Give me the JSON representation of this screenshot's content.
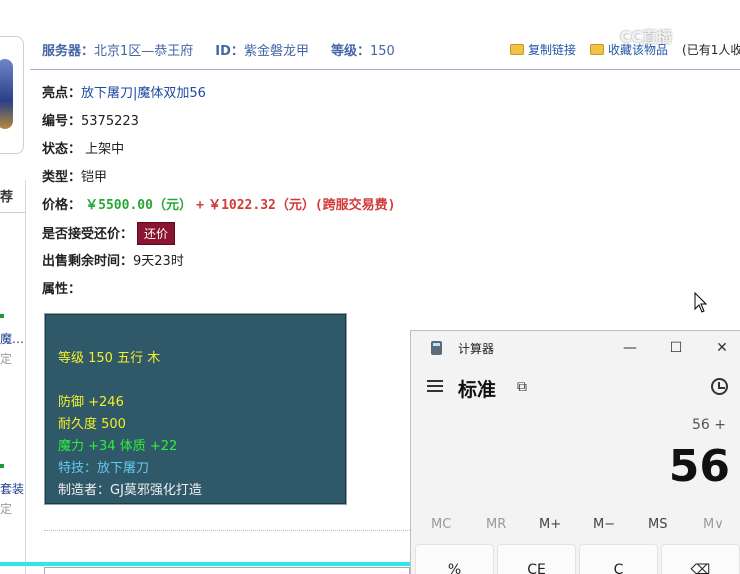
{
  "header": {
    "server_label": "服务器：",
    "server_value": "北京1区—恭王府",
    "id_label": "ID：",
    "id_value": "紫金磐龙甲",
    "level_label": "等级：",
    "level_value": "150",
    "copy_link": "复制链接",
    "favorite": "收藏该物品",
    "favorited_count": "(已有1人收"
  },
  "watermark": "CC直播",
  "sidebar": {
    "tab_label": "荐",
    "item1": "魔…",
    "item1_sub": "定",
    "item2": "套装",
    "item2_sub": "定"
  },
  "details": {
    "highlight_label": "亮点：",
    "highlight_value": "放下屠刀|魔体双加56",
    "number_label": "编号：",
    "number_value": "5375223",
    "status_label": "状态：",
    "status_value": "上架中",
    "type_label": "类型：",
    "type_value": "铠甲",
    "price_label": "价格：",
    "price_main": "￥5500.00（元）",
    "price_plus": "+",
    "price_extra": "￥1022.32（元）(跨服交易费)",
    "haggle_label": "是否接受还价：",
    "haggle_button": "还价",
    "time_label": "出售剩余时间：",
    "time_value": "9天23时",
    "attr_label": "属性："
  },
  "attributes": {
    "line1": "等级 150 五行 木",
    "line2": "防御 +246",
    "line3": "耐久度 500",
    "line4": "魔力 +34 体质 +22",
    "line5": "特技：放下屠刀",
    "line6": "制造者：GJ莫邪强化打造"
  },
  "calculator": {
    "title": "计算器",
    "minimize": "—",
    "maximize": "☐",
    "close": "✕",
    "mode": "标准",
    "keep_on_top": "⧉",
    "expression": "56 +",
    "display": "56",
    "memory": [
      "MC",
      "MR",
      "M+",
      "M−",
      "MS",
      "M∨"
    ],
    "keys": [
      "%",
      "CE",
      "C",
      "⌫"
    ]
  },
  "colors": {
    "attr_bg": "#2f5868",
    "haggle_bg": "#8a1530",
    "accent_blue": "#4467a6",
    "cyan_bar": "#2de8e8"
  }
}
